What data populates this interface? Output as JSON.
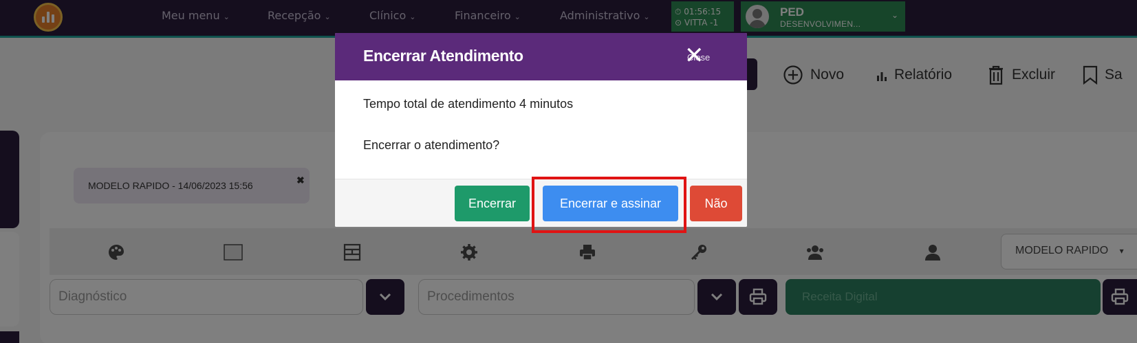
{
  "nav": {
    "logo_icon": "bar-chart-logo",
    "menu_items": [
      {
        "label": "Meu menu"
      },
      {
        "label": "Recepção"
      },
      {
        "label": "Clínico"
      },
      {
        "label": "Financeiro"
      },
      {
        "label": "Administrativo"
      }
    ],
    "caret": "⌄",
    "timer": {
      "time": "01:56:15",
      "location": "VITTA -1"
    },
    "user": {
      "name": "PED",
      "subtitle": "DESENVOLVIMEN..."
    }
  },
  "toolbar": {
    "new_label": "Novo",
    "report_label": "Relatório",
    "delete_label": "Excluir",
    "save_label": "Sa"
  },
  "card": {
    "model_chip_label": "MODELO RAPIDO - 14/06/2023 15:56",
    "model_chip_close": "✖",
    "model_select_value": "MODELO RAPIDO",
    "model_select_caret": "▾",
    "icons": [
      "palette-icon",
      "image-icon",
      "table-icon",
      "gear-icon",
      "print-icon",
      "key-icon",
      "users-icon",
      "user-icon"
    ],
    "diagnostico_placeholder": "Diagnóstico",
    "procedimentos_placeholder": "Procedimentos",
    "receita_label": "Receita Digital"
  },
  "modal": {
    "title": "Encerrar Atendimento",
    "close_label": "Close",
    "close_glyph": "✕",
    "message": "Tempo total de atendimento 4 minutos",
    "question": "Encerrar o atendimento?",
    "btn_encerrar": "Encerrar",
    "btn_encerrar_assinar": "Encerrar e assinar",
    "btn_nao": "Não"
  },
  "colors": {
    "nav_bg": "#2a1c3d",
    "modal_header": "#5b2a7a",
    "encerrar_green": "#1e9a6a",
    "assinar_blue": "#3d8df0",
    "nao_red": "#de4a36",
    "highlight_red": "#e01313"
  }
}
